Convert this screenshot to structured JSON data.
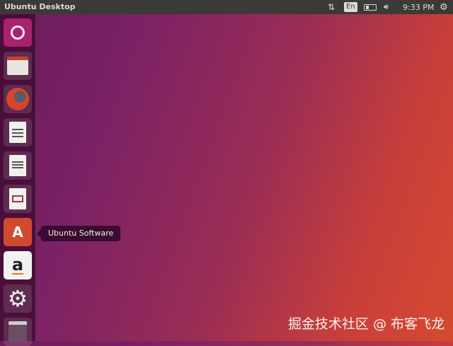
{
  "topbar": {
    "title": "Ubuntu Desktop",
    "keyboard": "En",
    "clock": "9:33 PM"
  },
  "launcher": {
    "items": [
      "Ubuntu Dash",
      "Files",
      "Firefox",
      "LibreOffice Writer",
      "LibreOffice Calc",
      "LibreOffice Impress",
      "Ubuntu Software",
      "Amazon",
      "System Settings",
      "Trash"
    ]
  },
  "tooltip": "Ubuntu Software",
  "watermark": "掘金技术社区 @ 布客飞龙"
}
